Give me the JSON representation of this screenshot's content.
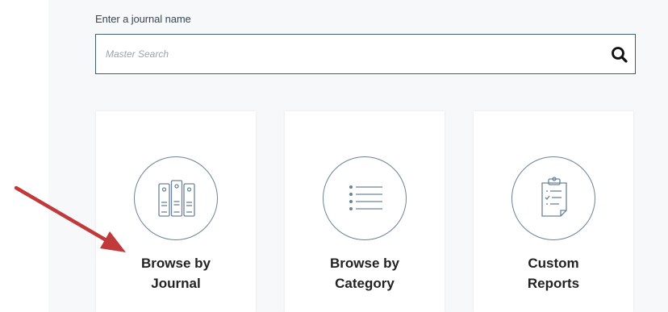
{
  "search": {
    "label": "Enter a journal name",
    "placeholder": "Master Search",
    "value": ""
  },
  "cards": [
    {
      "line1": "Browse by",
      "line2": "Journal",
      "icon": "journal-binders-icon"
    },
    {
      "line1": "Browse by",
      "line2": "Category",
      "icon": "list-icon"
    },
    {
      "line1": "Custom",
      "line2": "Reports",
      "icon": "clipboard-report-icon"
    }
  ],
  "colors": {
    "accent": "#3f5d73",
    "icon_stroke": "#6a8398",
    "annotation_arrow": "#c0393b",
    "panel_background": "#f7f8fa"
  }
}
